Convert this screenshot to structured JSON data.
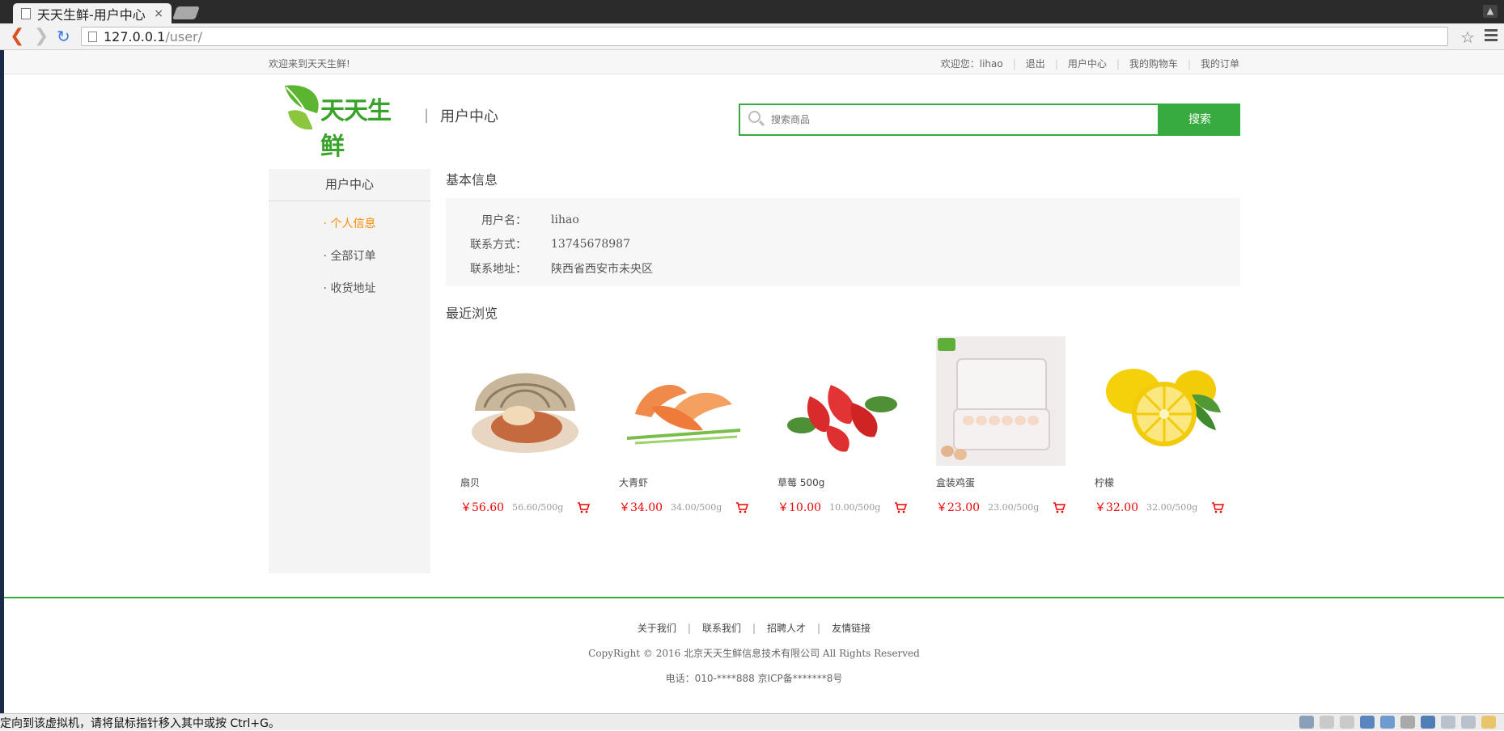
{
  "browser": {
    "tab_title": "天天生鲜-用户中心",
    "tab_close": "×",
    "url_host": "127.0.0.1",
    "url_path": "/user/"
  },
  "top_strip": {
    "welcome": "欢迎来到天天生鲜!",
    "greeting": "欢迎您：lihao",
    "logout": "退出",
    "user_center": "用户中心",
    "cart": "我的购物车",
    "orders": "我的订单",
    "separator": "|"
  },
  "header": {
    "logo_text": "天天生鲜",
    "divider": "|",
    "title": "用户中心"
  },
  "search": {
    "placeholder": "搜索商品",
    "button": "搜索"
  },
  "sidebar": {
    "title": "用户中心",
    "items": [
      {
        "label": "· 个人信息",
        "active": true
      },
      {
        "label": "· 全部订单",
        "active": false
      },
      {
        "label": "· 收货地址",
        "active": false
      }
    ]
  },
  "basic_info": {
    "title": "基本信息",
    "rows": [
      {
        "key": "用户名：",
        "value": "lihao"
      },
      {
        "key": "联系方式：",
        "value": "13745678987"
      },
      {
        "key": "联系地址：",
        "value": "陕西省西安市未央区"
      }
    ]
  },
  "recent": {
    "title": "最近浏览",
    "goods": [
      {
        "name": "扇贝",
        "price": "￥56.60",
        "unit": "56.60/500g"
      },
      {
        "name": "大青虾",
        "price": "￥34.00",
        "unit": "34.00/500g"
      },
      {
        "name": "草莓 500g",
        "price": "￥10.00",
        "unit": "10.00/500g"
      },
      {
        "name": "盒装鸡蛋",
        "price": "￥23.00",
        "unit": "23.00/500g"
      },
      {
        "name": "柠檬",
        "price": "￥32.00",
        "unit": "32.00/500g"
      }
    ]
  },
  "footer": {
    "links": [
      "关于我们",
      "联系我们",
      "招聘人才",
      "友情链接"
    ],
    "separator": "|",
    "copyright": "CopyRight © 2016 北京天天生鲜信息技术有限公司 All Rights Reserved",
    "phone": "电话：010-****888 京ICP备*******8号"
  },
  "vm_status": {
    "message": "定向到该虚拟机，请将鼠标指针移入其中或按 Ctrl+G。"
  },
  "colors": {
    "accent_green": "#37ab40",
    "active_orange": "#ff8800",
    "price_red": "#ee0000"
  }
}
